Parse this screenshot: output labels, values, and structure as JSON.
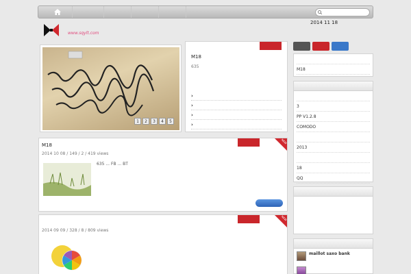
{
  "nav": {
    "home_icon": "home-icon",
    "items": [
      "",
      "",
      "",
      ""
    ],
    "search_placeholder": ""
  },
  "header": {
    "logo_icon": "bowtie-logo-icon",
    "site_name": "",
    "site_url": "www.sqylt.com",
    "date_text": "2014 11 18"
  },
  "slider": {
    "image": "handwriting-photo",
    "pages": [
      "1",
      "2",
      "3",
      "4",
      "5"
    ]
  },
  "feature": {
    "tab_label": "",
    "title": "M18",
    "excerpt": "635",
    "links": [
      "",
      "",
      "",
      ""
    ]
  },
  "posts": [
    {
      "title": "M18",
      "tag_label": "",
      "ribbon_label": "NEW",
      "meta": "2014 10 08 / 149 / 2 / 419 views",
      "excerpt": "635 ... FB ... BT",
      "more_label": "",
      "thumb": "grass-photo"
    },
    {
      "title": "",
      "tag_label": "",
      "ribbon_label": "NEW",
      "meta": "2014 09 09 / 328 / 8 / 809 views",
      "excerpt": "",
      "more_label": "",
      "thumb": "lemon-color-wheel"
    }
  ],
  "sidebar": {
    "tabs": [
      {
        "label": "",
        "color": "#555555"
      },
      {
        "label": "",
        "color": "#c9262b"
      },
      {
        "label": "",
        "color": "#3a78c9"
      }
    ],
    "top_list": [
      "",
      "M18"
    ],
    "recent": {
      "title": "",
      "items": [
        "",
        "3",
        "PP V1.2.8",
        "COMODO",
        "",
        "2013",
        "",
        "18",
        "QQ"
      ]
    },
    "tags": {
      "title": "",
      "items": [
        "",
        "",
        "",
        "",
        "",
        "",
        "",
        ""
      ]
    },
    "comments": {
      "title": "",
      "items": [
        {
          "name": "maillot saxo bank",
          "text": ""
        },
        {
          "name": "",
          "text": ""
        }
      ]
    }
  },
  "colors": {
    "accent_red": "#c9262b",
    "accent_blue": "#3a78c9",
    "logo_pink": "#e0467a"
  }
}
